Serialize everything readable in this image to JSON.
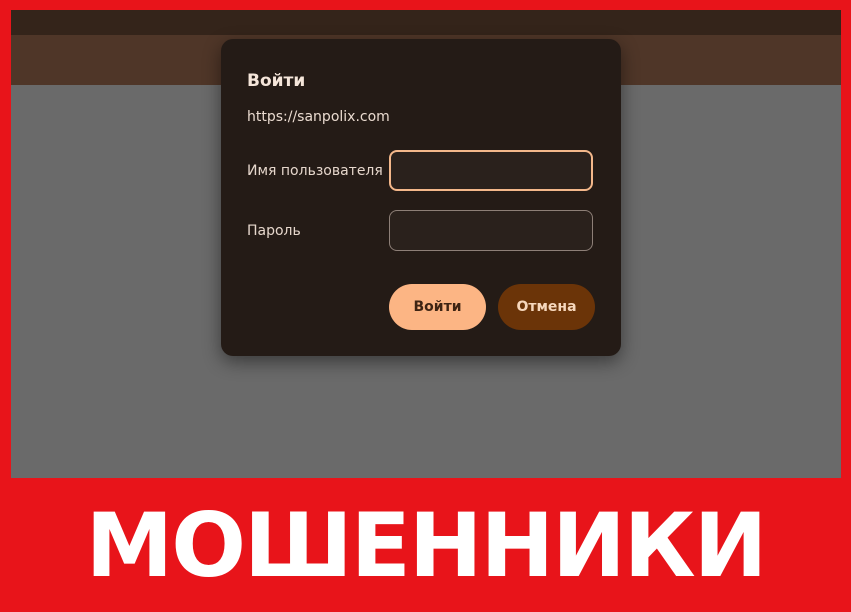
{
  "dialog": {
    "title": "Войти",
    "origin": "https://sanpolix.com",
    "username_label": "Имя пользователя",
    "username_value": "",
    "password_label": "Пароль",
    "password_value": "",
    "login_button": "Войти",
    "cancel_button": "Отмена"
  },
  "banner": {
    "text": "МОШЕННИКИ"
  },
  "colors": {
    "frame_red": "#e8141a",
    "dialog_bg": "#241b16",
    "accent_peach": "#fcb584",
    "cancel_brown": "#6b3408"
  }
}
